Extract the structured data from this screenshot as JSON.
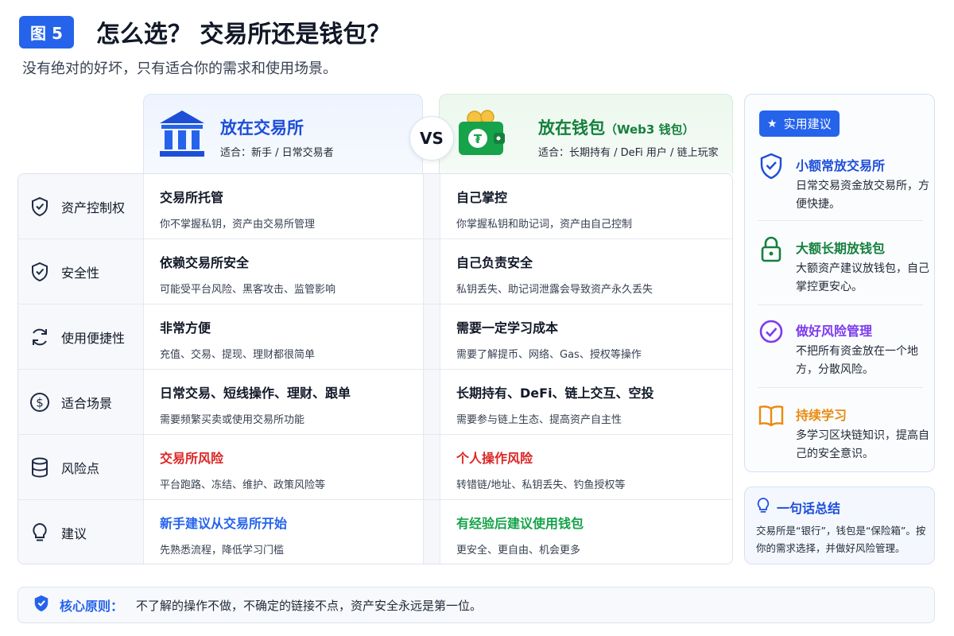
{
  "header": {
    "figure_badge": "图 5",
    "title": "怎么选？ 交易所还是钱包？",
    "subtitle": "没有绝对的好坏，只有适合你的需求和使用场景。"
  },
  "columns": {
    "exchange": {
      "title": "放在交易所",
      "audience": "适合：新手 / 日常交易者"
    },
    "vs_label": "VS",
    "wallet": {
      "title": "放在钱包",
      "title_suffix": "（Web3 钱包）",
      "audience": "适合：长期持有 / DeFi 用户 / 链上玩家"
    }
  },
  "rows": [
    {
      "label": "资产控制权",
      "icon": "shield-icon",
      "exchange": {
        "title": "交易所托管",
        "desc": "你不掌握私钥，资产由交易所管理"
      },
      "wallet": {
        "title": "自己掌控",
        "desc": "你掌握私钥和助记词，资产由自己控制"
      }
    },
    {
      "label": "安全性",
      "icon": "shield-check-icon",
      "exchange": {
        "title": "依赖交易所安全",
        "desc": "可能受平台风险、黑客攻击、监管影响"
      },
      "wallet": {
        "title": "自己负责安全",
        "desc": "私钥丢失、助记词泄露会导致资产永久丢失"
      }
    },
    {
      "label": "使用便捷性",
      "icon": "refresh-icon",
      "exchange": {
        "title": "非常方便",
        "desc": "充值、交易、提现、理财都很简单"
      },
      "wallet": {
        "title": "需要一定学习成本",
        "desc": "需要了解提币、网络、Gas、授权等操作"
      }
    },
    {
      "label": "适合场景",
      "icon": "dollar-icon",
      "exchange": {
        "title": "日常交易、短线操作、理财、跟单",
        "desc": "需要频繁买卖或使用交易所功能"
      },
      "wallet": {
        "title": "长期持有、DeFi、链上交互、空投",
        "desc": "需要参与链上生态、提高资产自主性"
      }
    },
    {
      "label": "风险点",
      "icon": "database-icon",
      "exchange": {
        "title": "交易所风险",
        "desc": "平台跑路、冻结、维护、政策风险等"
      },
      "wallet": {
        "title": "个人操作风险",
        "desc": "转错链/地址、私钥丢失、钓鱼授权等"
      }
    },
    {
      "label": "建议",
      "icon": "lightbulb-icon",
      "exchange": {
        "title": "新手建议从交易所开始",
        "desc": "先熟悉流程，降低学习门槛"
      },
      "wallet": {
        "title": "有经验后建议使用钱包",
        "desc": "更安全、更自由、机会更多"
      }
    }
  ],
  "tips": {
    "badge": "实用建议",
    "items": [
      {
        "title": "小额常放交易所",
        "desc": "日常交易资金放交易所，方便快捷。",
        "icon": "shield-icon",
        "color": "#1d4ed8"
      },
      {
        "title": "大额长期放钱包",
        "desc": "大额资产建议放钱包，自己掌控更安心。",
        "icon": "lock-icon",
        "color": "#15803d"
      },
      {
        "title": "做好风险管理",
        "desc": "不把所有资金放在一个地方，分散风险。",
        "icon": "check-circle-icon",
        "color": "#7c3aed"
      },
      {
        "title": "持续学习",
        "desc": "多学习区块链知识，提高自己的安全意识。",
        "icon": "book-icon",
        "color": "#ea8a0c"
      }
    ]
  },
  "summary": {
    "title": "一句话总结",
    "text": "交易所是“银行”，钱包是“保险箱”。按你的需求选择，并做好风险管理。"
  },
  "principle": {
    "label": "核心原则：",
    "text": "不了解的操作不做，不确定的链接不点，资产安全永远是第一位。"
  },
  "colors": {
    "primary": "#2563eb",
    "green": "#16a34a",
    "red": "#dc2626",
    "purple": "#7c3aed",
    "orange": "#ea8a0c"
  }
}
